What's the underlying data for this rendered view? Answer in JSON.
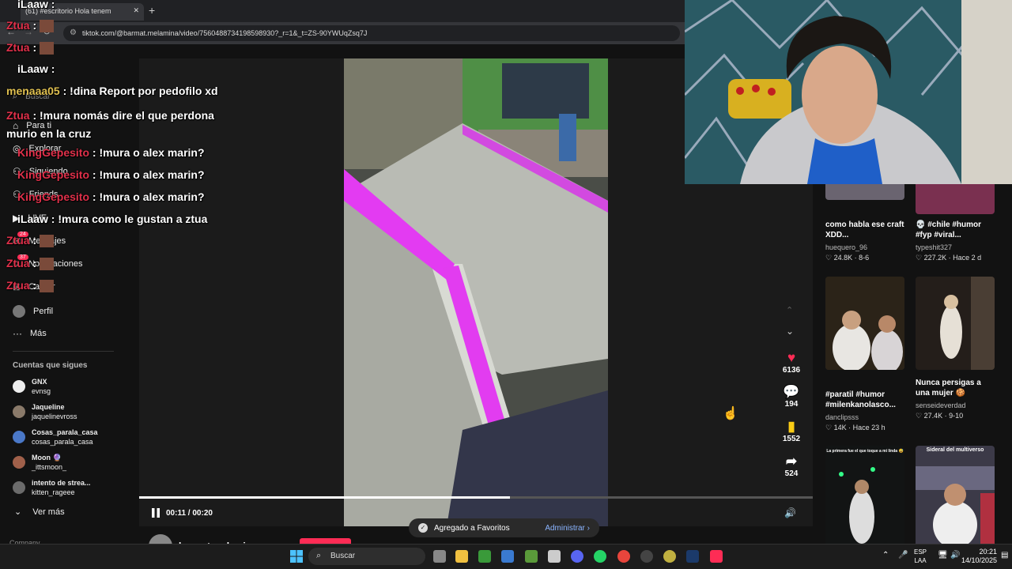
{
  "browser": {
    "tab_title": "(61) #escritorio Hola tenem",
    "url": "tiktok.com/@barmat.melamina/video/7560488734198598930?_r=1&_t=ZS-90YWUqZsq7J"
  },
  "sidebar": {
    "search_placeholder": "Buscar",
    "items": [
      {
        "label": "Para ti"
      },
      {
        "label": "Explorar"
      },
      {
        "label": "Siguiendo"
      },
      {
        "label": "Friends"
      },
      {
        "label": "LIVE"
      },
      {
        "label": "Mensajes",
        "badge": "24"
      },
      {
        "label": "Notificaciones",
        "badge": "37"
      },
      {
        "label": "Cargar"
      },
      {
        "label": "Perfil"
      },
      {
        "label": "Más"
      }
    ],
    "following_title": "Cuentas que sigues",
    "following": [
      {
        "name": "GNX",
        "handle": "evnsg"
      },
      {
        "name": "Jaqueline",
        "handle": "jaquelinevross"
      },
      {
        "name": "Cosas_parala_casa",
        "handle": "cosas_parala_casa"
      },
      {
        "name": "Moon 🔮",
        "handle": "_ittsmoon_"
      },
      {
        "name": "intento de strea...",
        "handle": "kitten_rageee"
      }
    ],
    "see_more": "Ver más",
    "company": "Company"
  },
  "player": {
    "time": "00:11 / 00:20",
    "progress": 0.55,
    "author": "barmat.melamina"
  },
  "actions": {
    "likes": "6136",
    "comments": "194",
    "saves": "1552",
    "shares": "524"
  },
  "toast": {
    "message": "Agregado a Favoritos",
    "link": "Administrar"
  },
  "feed": [
    {
      "desc": "como habla ese craft XDD...",
      "user": "huequero_96",
      "meta": "♡ 24.8K · 8-6"
    },
    {
      "desc": "💀 #chile #humor #fyp #viral...",
      "user": "typeshit327",
      "meta": "♡ 227.2K · Hace 2 d"
    },
    {
      "desc": "#paratil #humor #milenkanolasco...",
      "user": "danclipsss",
      "meta": "♡ 14K · Hace 23 h"
    },
    {
      "desc": "Nunca persigas a una mujer 🍪",
      "user": "senseideverdad",
      "meta": "♡ 27.4K · 9-10"
    },
    {
      "thumb_text": "La primera fue el que toque a mi linda 😅"
    },
    {
      "thumb_text": "Sideral del multiverso"
    }
  ],
  "chat": [
    {
      "user": "iLaaw",
      "msg": ""
    },
    {
      "user": "Ztua",
      "msg": ""
    },
    {
      "user": "Ztua",
      "msg": ""
    },
    {
      "user": "iLaaw",
      "msg": ""
    },
    {
      "user": "menaaa05",
      "msg": "!dina Report por pedofilo xd"
    },
    {
      "user": "Ztua",
      "msg": "!mura nomás dire el que perdona murio en la cruz"
    },
    {
      "user": "KingGepesito",
      "msg": "!mura o alex marin?"
    },
    {
      "user": "KingGepesito",
      "msg": "!mura o alex marin?"
    },
    {
      "user": "KingGepesito",
      "msg": "!mura o alex marin?"
    },
    {
      "user": "iLaaw",
      "msg": "!mura como le gustan a ztua"
    },
    {
      "user": "Ztua",
      "msg": ""
    },
    {
      "user": "Ztua",
      "msg": ""
    },
    {
      "user": "Ztua",
      "msg": ""
    }
  ],
  "taskbar": {
    "search": "Buscar",
    "lang1": "ESP",
    "lang2": "LAA",
    "time": "20:21",
    "date": "14/10/2025"
  },
  "colors": {
    "tiktok_red": "#fe2c55",
    "chat_name_red": "#e0304a",
    "neon": "#e23cf0"
  }
}
